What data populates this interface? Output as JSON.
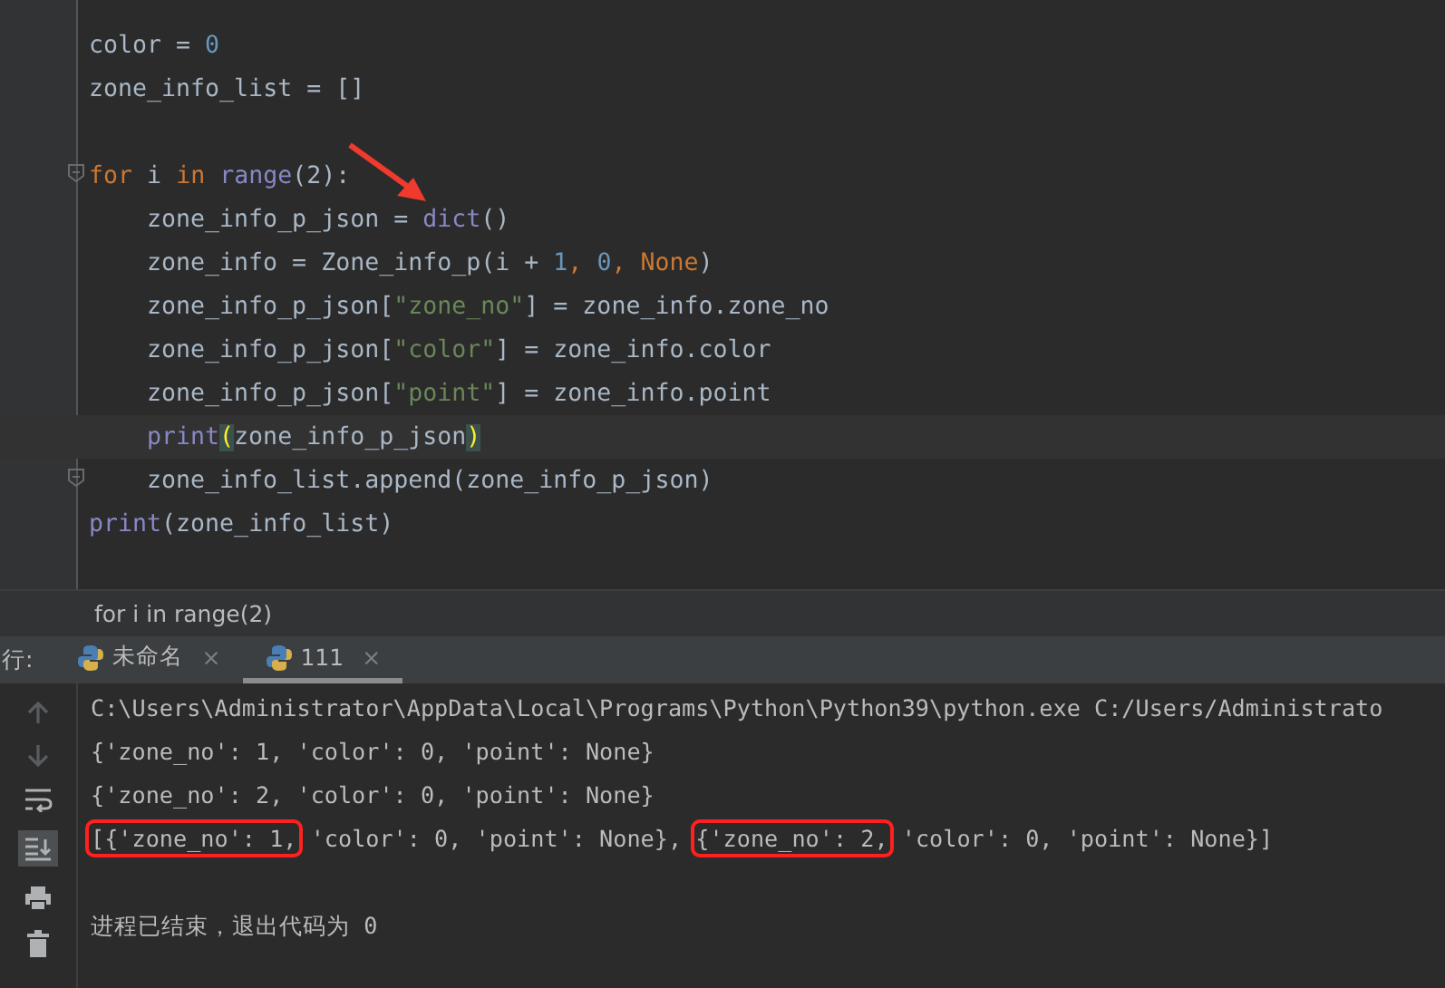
{
  "editor": {
    "lines": [
      {
        "fold": false,
        "current": false,
        "tokens": [
          {
            "text": "color = ",
            "kind": "plain"
          },
          {
            "text": "0",
            "kind": "number"
          }
        ]
      },
      {
        "fold": false,
        "current": false,
        "tokens": [
          {
            "text": "zone_info_list = []",
            "kind": "plain"
          }
        ]
      },
      {
        "kind": "blank"
      },
      {
        "fold": true,
        "current": false,
        "tokens": [
          {
            "text": "for",
            "kind": "keyword"
          },
          {
            "text": " i ",
            "kind": "plain"
          },
          {
            "text": "in",
            "kind": "keyword"
          },
          {
            "text": " range",
            "kind": "builtin"
          },
          {
            "text": "(2):",
            "kind": "plain"
          }
        ],
        "children": [
          {
            "fold": false,
            "current": false,
            "tokens": [
              {
                "text": "zone_info_p_json = ",
                "kind": "plain"
              },
              {
                "text": "dict",
                "kind": "builtin"
              },
              {
                "text": "()",
                "kind": "plain"
              }
            ]
          },
          {
            "fold": false,
            "current": false,
            "tokens": [
              {
                "text": "zone_info = Zone_info_p(i + ",
                "kind": "plain"
              },
              {
                "text": "1",
                "kind": "number"
              },
              {
                "text": ", ",
                "kind": "keyword"
              },
              {
                "text": "0",
                "kind": "number"
              },
              {
                "text": ", ",
                "kind": "keyword"
              },
              {
                "text": "None",
                "kind": "keyword"
              },
              {
                "text": ")",
                "kind": "plain"
              }
            ]
          },
          {
            "fold": false,
            "current": false,
            "tokens": [
              {
                "text": "zone_info_p_json[",
                "kind": "plain"
              },
              {
                "text": "\"zone_no\"",
                "kind": "string"
              },
              {
                "text": "] = zone_info.zone_no",
                "kind": "plain"
              }
            ]
          },
          {
            "fold": false,
            "current": false,
            "tokens": [
              {
                "text": "zone_info_p_json[",
                "kind": "plain"
              },
              {
                "text": "\"color\"",
                "kind": "string"
              },
              {
                "text": "] = zone_info.color",
                "kind": "plain"
              }
            ]
          },
          {
            "fold": false,
            "current": false,
            "tokens": [
              {
                "text": "zone_info_p_json[",
                "kind": "plain"
              },
              {
                "text": "\"point\"",
                "kind": "string"
              },
              {
                "text": "] = zone_info.point",
                "kind": "plain"
              }
            ]
          },
          {
            "fold": false,
            "current": true,
            "tokens": [
              {
                "text": "print",
                "kind": "builtin"
              },
              {
                "text": "(",
                "kind": "brace"
              },
              {
                "text": "zone_info_p_json",
                "kind": "plain"
              },
              {
                "text": ")",
                "kind": "brace"
              }
            ]
          },
          {
            "fold": true,
            "current": false,
            "tokens": [
              {
                "text": "zone_info_list.append(zone_info_p_json)",
                "kind": "plain"
              }
            ]
          }
        ]
      },
      {
        "fold": false,
        "current": false,
        "tokens": [
          {
            "text": "print",
            "kind": "builtin"
          },
          {
            "text": "(zone_info_list)",
            "kind": "plain"
          }
        ]
      }
    ]
  },
  "breadcrumb": "for i in range(2)",
  "run_panel": {
    "label": "行:",
    "tabs": [
      {
        "label": "未命名",
        "selected": false,
        "close": "×"
      },
      {
        "label": "111",
        "selected": true,
        "close": "×"
      }
    ],
    "output": [
      {
        "segments": [
          {
            "text": "C:\\Users\\Administrator\\AppData\\Local\\Programs\\Python\\Python39\\python.exe C:/Users/Administrato",
            "marked": false
          }
        ]
      },
      {
        "segments": [
          {
            "text": "{'zone_no': 1, 'color': 0, 'point': None}",
            "marked": false
          }
        ]
      },
      {
        "segments": [
          {
            "text": "{'zone_no': 2, 'color': 0, 'point': None}",
            "marked": false
          }
        ]
      },
      {
        "segments": [
          {
            "text": "[{'zone_no': 1,",
            "marked": true
          },
          {
            "text": " 'color': 0, 'point': None}, ",
            "marked": false
          },
          {
            "text": "{'zone_no': 2,",
            "marked": true
          },
          {
            "text": " 'color': 0, 'point': None}]",
            "marked": false
          }
        ]
      },
      {
        "kind": "blank"
      },
      {
        "segments": [
          {
            "text": "进程已结束，退出代码为 0",
            "marked": false
          }
        ]
      }
    ]
  }
}
